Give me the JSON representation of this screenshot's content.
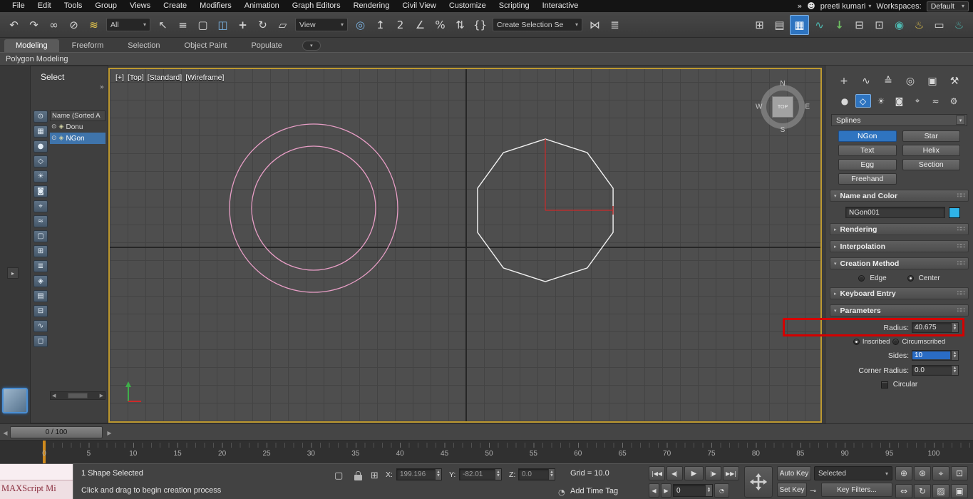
{
  "colors": {
    "accent_blue": "#2e74c0",
    "viewport_border": "#bd9930",
    "annotation_red": "#d40000",
    "donut_pink": "#e89ec6",
    "ngon_white": "#f2f2f2",
    "axis_red": "#cc2a2a",
    "axis_green": "#3fae4a",
    "selection_blue": "#3f74ab",
    "color_swatch": "#2fb4e9"
  },
  "icons": {
    "chevron_down": "▾",
    "chevron_right": "▸",
    "double_chevron": "»",
    "grip": "∷∷",
    "eye": "⊙",
    "spline_item": "◈",
    "spin_up": "▲",
    "spin_down": "▼",
    "arrow_left": "◀",
    "arrow_right": "▶",
    "user": "☻",
    "clock": "◔",
    "key": "⊸",
    "isolate": "▢",
    "offset_mode": "⊞"
  },
  "menubar": {
    "items": [
      "File",
      "Edit",
      "Tools",
      "Group",
      "Views",
      "Create",
      "Modifiers",
      "Animation",
      "Graph Editors",
      "Rendering",
      "Civil View",
      "Customize",
      "Scripting",
      "Interactive"
    ],
    "overflow": "»",
    "user": "preeti kumari",
    "workspaces_label": "Workspaces:",
    "workspace_value": "Default"
  },
  "toolbar": {
    "selection_filter": "All",
    "ref_coord": "View",
    "create_selection_set": "Create Selection Se",
    "icons": [
      {
        "name": "undo",
        "glyph": "↶"
      },
      {
        "name": "redo",
        "glyph": "↷"
      },
      {
        "name": "select-and-link",
        "glyph": "∞"
      },
      {
        "name": "unlink-selection",
        "glyph": "⊘"
      },
      {
        "name": "bind-to-space-warp",
        "glyph": "≋"
      },
      {
        "name": "select-object",
        "glyph": "↖"
      },
      {
        "name": "select-by-name",
        "glyph": "≡"
      },
      {
        "name": "rectangular-selection-region",
        "glyph": "▢"
      },
      {
        "name": "window-crossing",
        "glyph": "◫"
      },
      {
        "name": "select-and-move",
        "glyph": "+"
      },
      {
        "name": "select-and-rotate",
        "glyph": "↻"
      },
      {
        "name": "select-and-scale",
        "glyph": "▱"
      },
      {
        "name": "use-center",
        "glyph": "◎"
      },
      {
        "name": "select-and-manipulate",
        "glyph": "↥"
      },
      {
        "name": "snaps-toggle",
        "glyph": "2"
      },
      {
        "name": "angle-snap",
        "glyph": "∠"
      },
      {
        "name": "percent-snap",
        "glyph": "%"
      },
      {
        "name": "spinner-snap",
        "glyph": "⇅"
      },
      {
        "name": "named-selection-sets",
        "glyph": "{}"
      },
      {
        "name": "mirror",
        "glyph": "⋈"
      },
      {
        "name": "align",
        "glyph": "≣"
      },
      {
        "name": "layer-explorer",
        "glyph": "⊞"
      },
      {
        "name": "scene-explorer",
        "glyph": "▤"
      },
      {
        "name": "toggle-ribbon",
        "glyph": "▦"
      },
      {
        "name": "curve-editor",
        "glyph": "∿"
      },
      {
        "name": "download-assets",
        "glyph": "↓"
      },
      {
        "name": "dope-sheet",
        "glyph": "⊟"
      },
      {
        "name": "schematic-view",
        "glyph": "⊡"
      },
      {
        "name": "material-editor",
        "glyph": "◉"
      },
      {
        "name": "render-setup",
        "glyph": "♨"
      },
      {
        "name": "rendered-frame-window",
        "glyph": "▭"
      },
      {
        "name": "render-production",
        "glyph": "♨"
      }
    ]
  },
  "ribbon": {
    "tabs": [
      "Modeling",
      "Freeform",
      "Selection",
      "Object Paint",
      "Populate"
    ],
    "active_tab": "Modeling",
    "collapsed_panel": "Polygon Modeling"
  },
  "explorer": {
    "title": "Select",
    "column_header": "Name (Sorted A",
    "rows": [
      {
        "name": "Donu"
      },
      {
        "name": "NGon"
      }
    ],
    "selected_row": "NGon",
    "tools": [
      {
        "name": "pick-filter",
        "glyph": "⊙"
      },
      {
        "name": "display-all",
        "glyph": "▦"
      },
      {
        "name": "display-geometry",
        "glyph": "●"
      },
      {
        "name": "display-shapes",
        "glyph": "◇"
      },
      {
        "name": "display-lights",
        "glyph": "☀"
      },
      {
        "name": "display-cameras",
        "glyph": "◙"
      },
      {
        "name": "display-helpers",
        "glyph": "⌖"
      },
      {
        "name": "display-spacewarps",
        "glyph": "≈"
      },
      {
        "name": "display-groups",
        "glyph": "▢"
      },
      {
        "name": "display-xrefs",
        "glyph": "⊞"
      },
      {
        "name": "display-bones",
        "glyph": "≣"
      },
      {
        "name": "display-containers",
        "glyph": "◈"
      },
      {
        "name": "display-materials",
        "glyph": "▤"
      },
      {
        "name": "display-frozen",
        "glyph": "⊟"
      },
      {
        "name": "sync-selection",
        "glyph": "∿"
      },
      {
        "name": "lock-explorer",
        "glyph": "◻"
      }
    ]
  },
  "viewport": {
    "labels": [
      "[+]",
      "[Top]",
      "[Standard]",
      "[Wireframe]"
    ],
    "viewcube": {
      "n": "N",
      "s": "S",
      "e": "E",
      "w": "W",
      "face": "TOP"
    }
  },
  "command_panel": {
    "tabs": [
      {
        "name": "create",
        "glyph": "+"
      },
      {
        "name": "modify",
        "glyph": "∿"
      },
      {
        "name": "hierarchy",
        "glyph": "≙"
      },
      {
        "name": "motion",
        "glyph": "◎"
      },
      {
        "name": "display",
        "glyph": "▣"
      },
      {
        "name": "utilities",
        "glyph": "⚒"
      }
    ],
    "categories": [
      {
        "name": "geometry",
        "glyph": "●"
      },
      {
        "name": "shapes",
        "glyph": "◇"
      },
      {
        "name": "lights",
        "glyph": "☀"
      },
      {
        "name": "cameras",
        "glyph": "◙"
      },
      {
        "name": "helpers",
        "glyph": "⌖"
      },
      {
        "name": "space-warps",
        "glyph": "≈"
      },
      {
        "name": "systems",
        "glyph": "⚙"
      }
    ],
    "active_category": "shapes",
    "subcategory": "Splines",
    "object_types": [
      "NGon",
      "Star",
      "Text",
      "Helix",
      "Egg",
      "Section",
      "Freehand"
    ],
    "active_object_type": "NGon",
    "name_and_color": {
      "title": "Name and Color",
      "value": "NGon001"
    },
    "rendering_title": "Rendering",
    "interpolation_title": "Interpolation",
    "creation_method": {
      "title": "Creation Method",
      "edge": "Edge",
      "center": "Center",
      "selected": "Center"
    },
    "keyboard_entry_title": "Keyboard Entry",
    "parameters": {
      "title": "Parameters",
      "radius_label": "Radius:",
      "radius_value": "40.675",
      "inscribed": "Inscribed",
      "circumscribed": "Circumscribed",
      "selected_mode": "Inscribed",
      "sides_label": "Sides:",
      "sides_value": "10",
      "corner_radius_label": "Corner Radius:",
      "corner_radius_value": "0.0",
      "circular": "Circular"
    }
  },
  "timeline": {
    "frame_display": "0 / 100",
    "ruler_ticks": [
      "0",
      "5",
      "10",
      "15",
      "20",
      "25",
      "30",
      "35",
      "40",
      "45",
      "50",
      "55",
      "60",
      "65",
      "70",
      "75",
      "80",
      "85",
      "90",
      "95",
      "100"
    ]
  },
  "statusbar": {
    "maxscript_label": "MAXScript Mi",
    "selection_status": "1 Shape Selected",
    "prompt": "Click and drag to begin creation process",
    "x_label": "X:",
    "x_value": "199.196",
    "y_label": "Y:",
    "y_value": "-82.01",
    "z_label": "Z:",
    "z_value": "0.0",
    "grid_label": "Grid = 10.0",
    "add_time_tag": "Add Time Tag",
    "frame_value": "0",
    "auto_key": "Auto Key",
    "set_key": "Set Key",
    "key_filter_scope": "Selected",
    "key_filters": "Key Filters...",
    "playback": [
      {
        "name": "go-to-start",
        "glyph": "|◀◀"
      },
      {
        "name": "previous-frame",
        "glyph": "◀|"
      },
      {
        "name": "play",
        "glyph": "▶"
      },
      {
        "name": "next-frame",
        "glyph": "|▶"
      },
      {
        "name": "go-to-end",
        "glyph": "▶▶|"
      }
    ],
    "nav_icons": [
      {
        "name": "zoom",
        "glyph": "⊕"
      },
      {
        "name": "zoom-all",
        "glyph": "⊛"
      },
      {
        "name": "zoom-extents",
        "glyph": "⌖"
      },
      {
        "name": "zoom-extents-all",
        "glyph": "⊡"
      },
      {
        "name": "pan-view",
        "glyph": "⇔"
      },
      {
        "name": "orbit",
        "glyph": "↻"
      },
      {
        "name": "field-of-view",
        "glyph": "▨"
      },
      {
        "name": "maximize-viewport",
        "glyph": "▣"
      }
    ]
  }
}
